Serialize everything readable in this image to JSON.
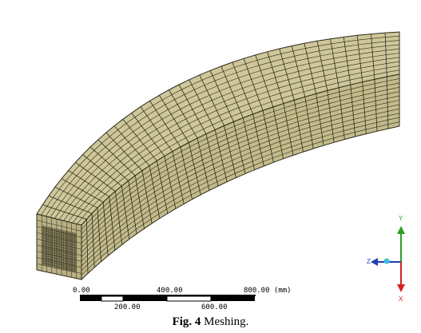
{
  "figure": {
    "caption_label": "Fig. 4",
    "caption_text": "Meshing."
  },
  "scale_bar": {
    "top_labels": [
      "0.00",
      "400.00",
      "800.00 (mm)"
    ],
    "bottom_labels": [
      "200.00",
      "600.00"
    ]
  },
  "triad": {
    "labels": [
      "Y",
      "Z",
      "X"
    ],
    "colors": {
      "y": "#2a9d2a",
      "z": "#1f3fb8",
      "x": "#d42020",
      "center": "#3fbfd8"
    }
  },
  "mesh": {
    "fill_color": "#cfc79a",
    "line_color": "#2c2a18"
  }
}
